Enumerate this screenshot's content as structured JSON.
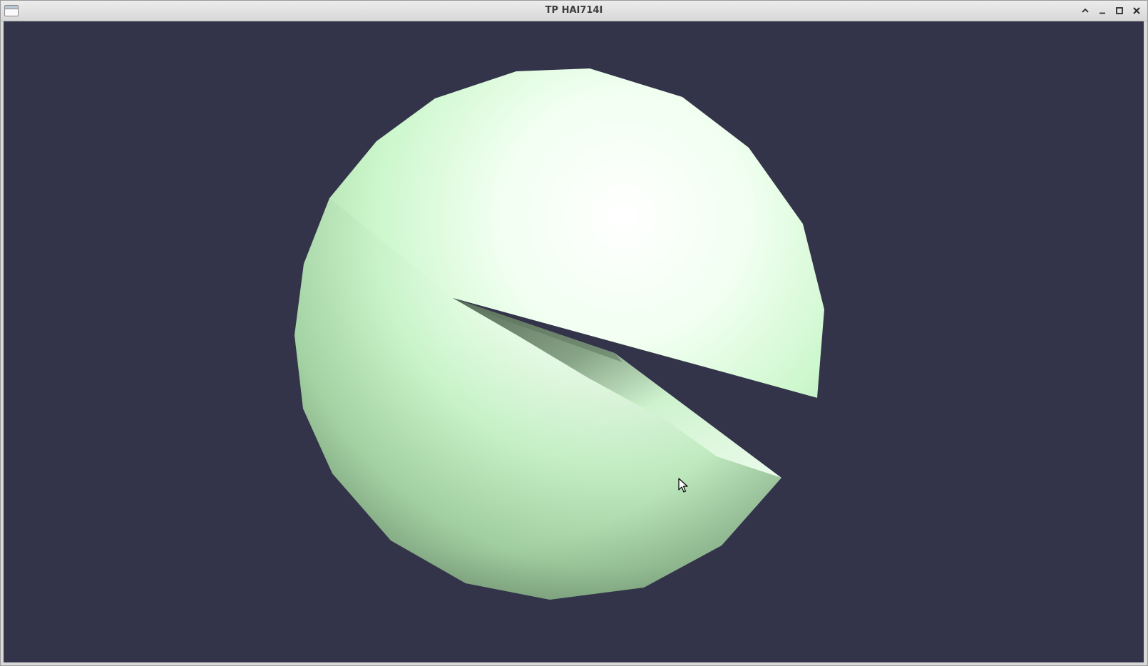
{
  "window": {
    "title": "TP HAI714I",
    "controls": [
      "shade-icon",
      "minimize-icon",
      "maximize-icon",
      "close-icon"
    ]
  },
  "scene": {
    "background_color": "#33334a",
    "sphere_highlight_color": "#ffffff",
    "sphere_base_color": "#c8f5c8",
    "sphere_shadow_color": "#6f8f6f"
  }
}
